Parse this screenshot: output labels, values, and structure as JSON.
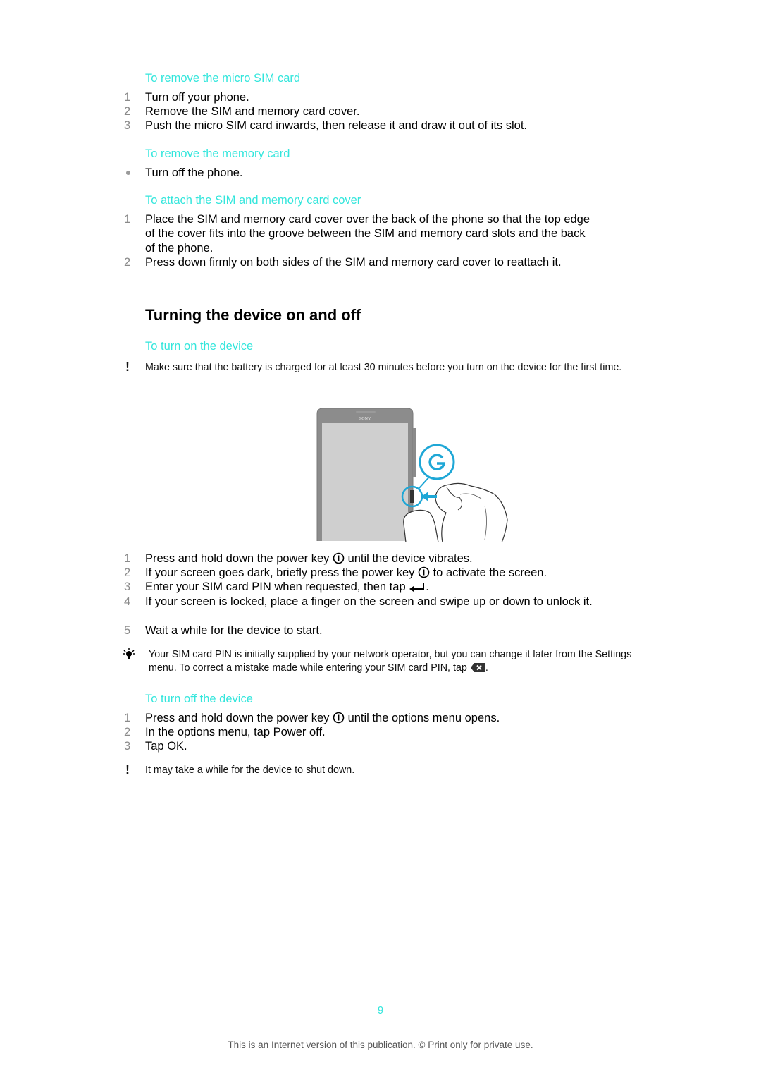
{
  "section_remove_sim": {
    "heading": "To remove the micro SIM card",
    "steps": [
      {
        "num": "1",
        "text": "Turn off your phone."
      },
      {
        "num": "2",
        "text": "Remove the SIM and memory card cover."
      },
      {
        "num": "3",
        "text": "Push the micro SIM card inwards, then release it and draw it out of its slot."
      }
    ]
  },
  "section_remove_memory": {
    "heading": "To remove the memory card",
    "bullets": [
      {
        "text": "Turn off the phone."
      }
    ]
  },
  "section_attach_cover": {
    "heading": "To attach the SIM and memory card cover",
    "steps": [
      {
        "num": "1",
        "text": "Place the SIM and memory card cover over the back of the phone so that the top edge of the cover fits into the groove between the SIM and memory card slots and the back of the phone."
      },
      {
        "num": "2",
        "text": "Press down firmly on both sides of the SIM and memory card cover to reattach it."
      }
    ]
  },
  "main_heading": "Turning the device on and off",
  "section_turn_on": {
    "heading": "To turn on the device",
    "warning": "Make sure that the battery is charged for at least 30 minutes before you turn on the device for the first time.",
    "illustration": {
      "brand_label": "SONY",
      "icon": "power-key-press-illustration"
    },
    "steps": [
      {
        "num": "1",
        "before": "Press and hold down the power key ",
        "icon": "power-icon",
        "after": " until the device vibrates."
      },
      {
        "num": "2",
        "before": "If your screen goes dark, briefly press the power key ",
        "icon": "power-icon",
        "after": " to activate the screen."
      },
      {
        "num": "3",
        "before": "Enter your SIM card PIN when requested, then tap ",
        "icon": "enter-icon",
        "after": "."
      },
      {
        "num": "4",
        "text": "If your screen is locked, place a finger on the screen and swipe up or down to unlock it."
      },
      {
        "num": "5",
        "text": "Wait a while for the device to start."
      }
    ],
    "tip": {
      "before": "Your SIM card PIN is initially supplied by your network operator, but you can change it later from the Settings menu. To correct a mistake made while entering your SIM card PIN, tap ",
      "icon": "backspace-icon",
      "after": "."
    }
  },
  "section_turn_off": {
    "heading": "To turn off the device",
    "steps": [
      {
        "num": "1",
        "before": "Press and hold down the power key ",
        "icon": "power-icon",
        "after": " until the options menu opens."
      },
      {
        "num": "2",
        "before": "In the options menu, tap ",
        "emph": "Power off",
        "after": "."
      },
      {
        "num": "3",
        "before": "Tap ",
        "emph": "OK",
        "after": "."
      }
    ],
    "warning": "It may take a while for the device to shut down."
  },
  "page_number": "9",
  "footer": "This is an Internet version of this publication. © Print only for private use.",
  "colors": {
    "heading_accent": "#33e6dc",
    "illustration_accent": "#1ea7d6",
    "step_number": "#8a8a8a"
  }
}
